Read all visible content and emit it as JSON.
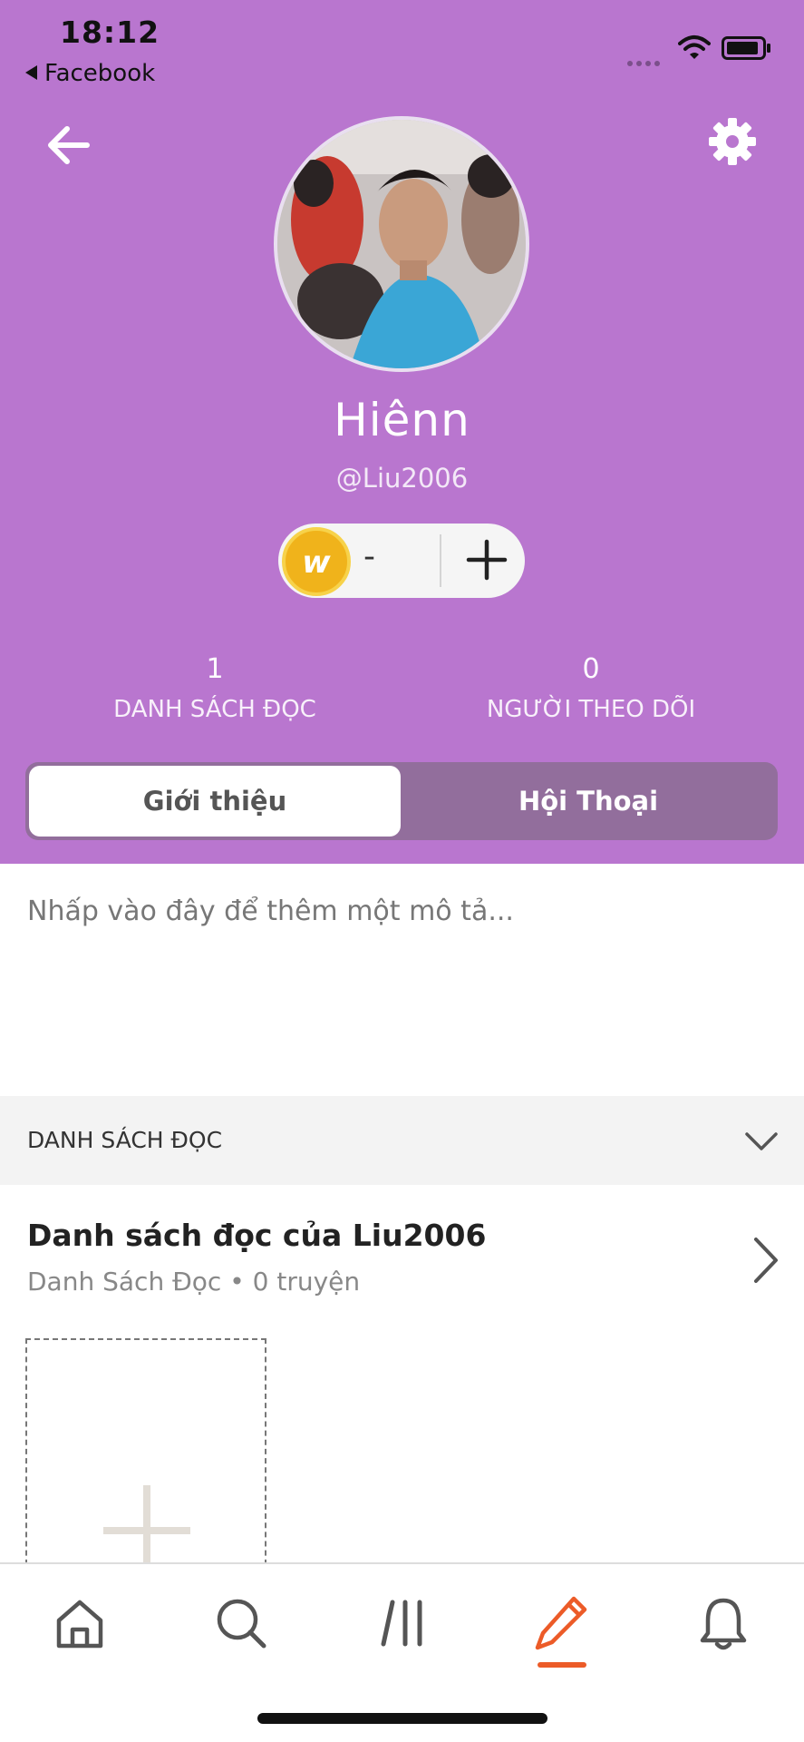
{
  "status_bar": {
    "time": "18:12",
    "back_app": "Facebook"
  },
  "profile": {
    "name": "Hiênn",
    "handle": "@Liu2006",
    "coin_minus": "-",
    "coin_letter": "w"
  },
  "stats": [
    {
      "count": "1",
      "label": "DANH SÁCH ĐỌC"
    },
    {
      "count": "0",
      "label": "NGƯỜI THEO DÕI"
    }
  ],
  "tabs": {
    "active": "Giới thiệu",
    "inactive": "Hội Thoại"
  },
  "description_placeholder": "Nhấp vào đây để thêm một mô tả...",
  "reading_lists": {
    "section_title": "DANH SÁCH ĐỌC",
    "list_title": "Danh sách đọc của Liu2006",
    "list_subtitle": "Danh Sách Đọc • 0 truyện"
  },
  "bottom_nav": [
    "home-icon",
    "search-icon",
    "library-icon",
    "write-icon",
    "notifications-icon"
  ],
  "colors": {
    "header_bg": "#b976cf",
    "tab_track": "#926e9c",
    "accent": "#ec5b28",
    "coin": "#f0b31b"
  }
}
